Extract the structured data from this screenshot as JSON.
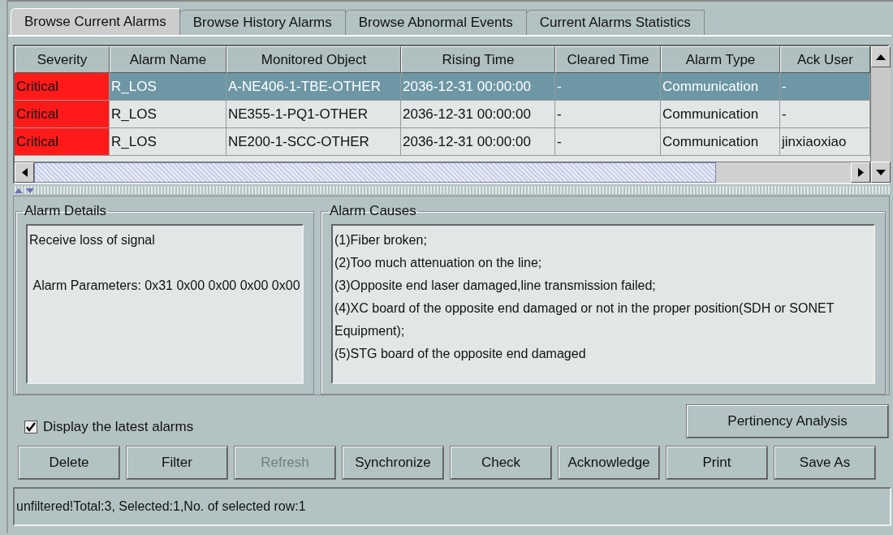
{
  "tabs": [
    {
      "label": "Browse Current Alarms",
      "selected": true
    },
    {
      "label": "Browse History Alarms",
      "selected": false
    },
    {
      "label": "Browse Abnormal Events",
      "selected": false
    },
    {
      "label": "Current Alarms Statistics",
      "selected": false
    }
  ],
  "table": {
    "columns": [
      "Severity",
      "Alarm Name",
      "Monitored Object",
      "Rising Time",
      "Cleared Time",
      "Alarm Type",
      "Ack User"
    ],
    "rows": [
      {
        "selected": true,
        "color": "#ff1a1a",
        "cells": [
          "Critical",
          "R_LOS",
          "A-NE406-1-TBE-OTHER",
          "2036-12-31 00:00:00",
          "-",
          "Communication",
          "-"
        ]
      },
      {
        "selected": false,
        "color": "#ff1a1a",
        "cells": [
          "Critical",
          "R_LOS",
          "NE355-1-PQ1-OTHER",
          "2036-12-31 00:00:00",
          "-",
          "Communication",
          "-"
        ]
      },
      {
        "selected": false,
        "color": "#ff1a1a",
        "cells": [
          "Critical",
          "R_LOS",
          "NE200-1-SCC-OTHER",
          "2036-12-31 00:00:00",
          "-",
          "Communication",
          "jinxiaoxiao"
        ]
      }
    ]
  },
  "alarm_details": {
    "title": "Alarm Details",
    "paragraphs": [
      "Receive loss of signal",
      " Alarm Parameters: 0x31 0x00 0x00 0x00 0x00"
    ]
  },
  "alarm_causes": {
    "title": "Alarm Causes",
    "lines": [
      "(1)Fiber broken;",
      "(2)Too much attenuation on the line;",
      "(3)Opposite end laser damaged,line transmission failed;",
      "(4)XC board of the opposite end damaged or not in the proper position(SDH or SONET Equipment);",
      "(5)STG board of the opposite end damaged"
    ]
  },
  "latest_alarms": {
    "label": "Display the latest alarms",
    "checked": true
  },
  "pertinency_button": "Pertinency Analysis",
  "buttons": [
    {
      "label": "Delete",
      "disabled": false
    },
    {
      "label": "Filter",
      "disabled": false
    },
    {
      "label": "Refresh",
      "disabled": true
    },
    {
      "label": "Synchronize",
      "disabled": false
    },
    {
      "label": "Check",
      "disabled": false
    },
    {
      "label": "Acknowledge",
      "disabled": false
    },
    {
      "label": "Print",
      "disabled": false
    },
    {
      "label": "Save As",
      "disabled": false
    }
  ],
  "status_bar": "unfiltered!Total:3, Selected:1,No. of selected row:1"
}
